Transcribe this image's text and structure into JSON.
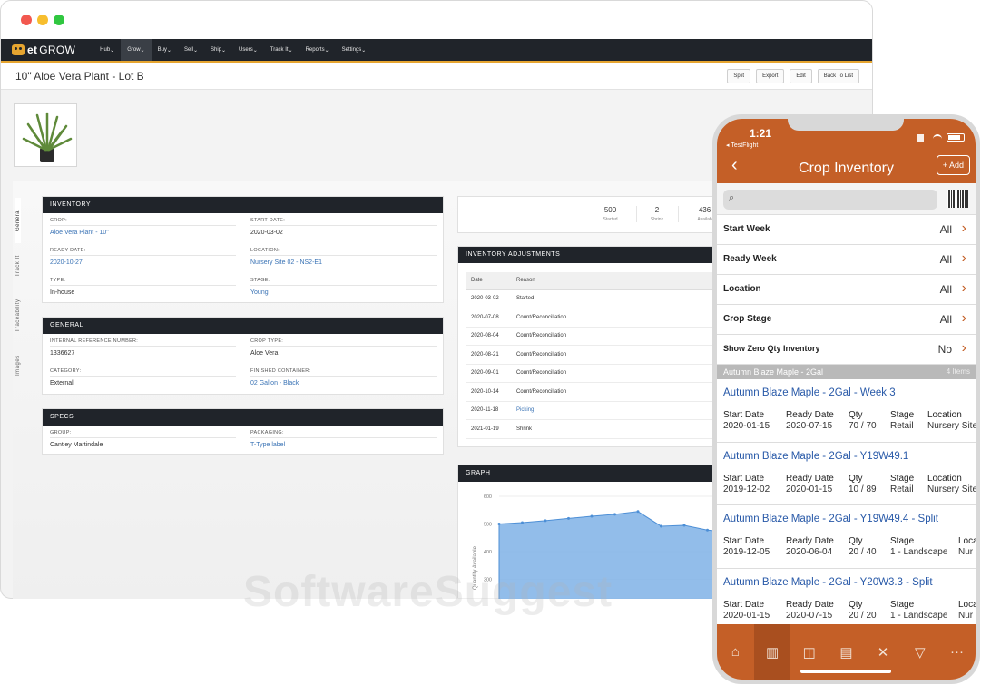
{
  "nav": {
    "logo": "GROW",
    "logo_prefix": "et",
    "items": [
      "Hub",
      "Grow",
      "Buy",
      "Sell",
      "Ship",
      "Users",
      "Track It",
      "Reports",
      "Settings"
    ]
  },
  "page": {
    "title": "10\" Aloe Vera Plant - Lot B",
    "buttons": [
      "Split",
      "Export",
      "Edit",
      "Back To List"
    ]
  },
  "sidetabs": [
    "General",
    "Track It",
    "Traceability",
    "Images"
  ],
  "inventory": {
    "header": "INVENTORY",
    "crop_label": "CROP:",
    "crop": "Aloe Vera Plant - 10\"",
    "start_label": "START DATE:",
    "start": "2020-03-02",
    "ready_label": "READY DATE:",
    "ready": "2020-10-27",
    "location_label": "LOCATION:",
    "location": "Nursery Site 02 - NS2-E1",
    "type_label": "TYPE:",
    "type": "In-house",
    "stage_label": "STAGE:",
    "stage": "Young"
  },
  "general": {
    "header": "GENERAL",
    "ref_label": "INTERNAL REFERENCE NUMBER:",
    "ref": "1336627",
    "croptype_label": "CROP TYPE:",
    "croptype": "Aloe Vera",
    "category_label": "CATEGORY:",
    "category": "External",
    "container_label": "FINISHED CONTAINER:",
    "container": "02 Gallon - Black"
  },
  "specs": {
    "header": "SPECS",
    "group_label": "GROUP:",
    "group": "Cantley Martindale",
    "packaging_label": "PACKAGING:",
    "packaging": "T-Type label"
  },
  "stats": [
    {
      "num": "500",
      "label": "Started"
    },
    {
      "num": "2",
      "label": "Shrink"
    },
    {
      "num": "436",
      "label": "Availab"
    }
  ],
  "adjustments": {
    "header": "INVENTORY ADJUSTMENTS",
    "col_date": "Date",
    "col_reason": "Reason",
    "rows": [
      {
        "date": "2020-03-02",
        "reason": "Started"
      },
      {
        "date": "2020-07-08",
        "reason": "Count/Reconciliation"
      },
      {
        "date": "2020-08-04",
        "reason": "Count/Reconciliation"
      },
      {
        "date": "2020-08-21",
        "reason": "Count/Reconciliation"
      },
      {
        "date": "2020-09-01",
        "reason": "Count/Reconciliation"
      },
      {
        "date": "2020-10-14",
        "reason": "Count/Reconciliation"
      },
      {
        "date": "2020-11-18",
        "reason": "Picking"
      },
      {
        "date": "2021-01-19",
        "reason": "Shrink"
      }
    ]
  },
  "graph": {
    "header": "GRAPH",
    "ylabel": "Quantity Available",
    "yticks": [
      "600",
      "500",
      "400",
      "300",
      "200"
    ]
  },
  "chart_data": {
    "type": "area",
    "title": "GRAPH",
    "ylabel": "Quantity Available",
    "xlabel": "",
    "ylim": [
      200,
      600
    ],
    "values": [
      500,
      505,
      512,
      520,
      528,
      535,
      545,
      492,
      495,
      478,
      470
    ],
    "color": "#7fb1e6"
  },
  "phone": {
    "time": "1:21",
    "testflight": "◂ TestFlight",
    "title": "Crop Inventory",
    "add": "+ Add",
    "filters": [
      {
        "label": "Start Week",
        "value": "All"
      },
      {
        "label": "Ready Week",
        "value": "All"
      },
      {
        "label": "Location",
        "value": "All"
      },
      {
        "label": "Crop Stage",
        "value": "All"
      },
      {
        "label": "Show Zero Qty Inventory",
        "value": "No"
      }
    ],
    "group": {
      "name": "Autumn Blaze Maple - 2Gal",
      "count": "4 Items"
    },
    "col_start": "Start Date",
    "col_ready": "Ready Date",
    "col_qty": "Qty",
    "col_stage": "Stage",
    "col_location": "Location",
    "items": [
      {
        "title": "Autumn Blaze Maple - 2Gal - Week 3",
        "start": "2020-01-15",
        "ready": "2020-07-15",
        "qty": "70 / 70",
        "stage": "Retail",
        "location": "Nursery Site"
      },
      {
        "title": "Autumn Blaze Maple - 2Gal - Y19W49.1",
        "start": "2019-12-02",
        "ready": "2020-01-15",
        "qty": "10 / 89",
        "stage": "Retail",
        "location": "Nursery Site"
      },
      {
        "title": "Autumn Blaze Maple - 2Gal - Y19W49.4 - Split",
        "start": "2019-12-05",
        "ready": "2020-06-04",
        "qty": "20 / 40",
        "stage": "1 - Landscape",
        "location": "Nur"
      },
      {
        "title": "Autumn Blaze Maple - 2Gal - Y20W3.3 - Split",
        "start": "2020-01-15",
        "ready": "2020-07-15",
        "qty": "20 / 20",
        "stage": "1 - Landscape",
        "location": "Nur"
      }
    ],
    "col_location_short": "Loca"
  },
  "watermark": "SoftwareSuggest"
}
